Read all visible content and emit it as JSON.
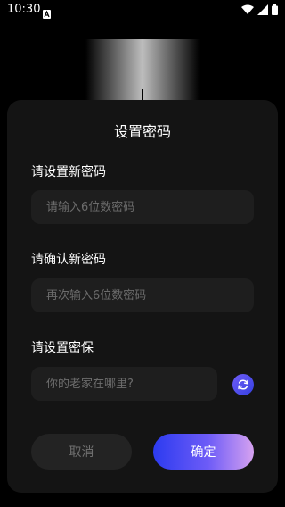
{
  "status": {
    "time": "10:30"
  },
  "dialog": {
    "title": "设置密码",
    "new_password_label": "请设置新密码",
    "new_password_placeholder": "请输入6位数密码",
    "confirm_password_label": "请确认新密码",
    "confirm_password_placeholder": "再次输入6位数密码",
    "security_label": "请设置密保",
    "security_placeholder": "你的老家在哪里?",
    "cancel": "取消",
    "confirm": "确定"
  },
  "colors": {
    "accent_start": "#2c3bf0",
    "accent_end": "#d6a2f0",
    "sheet_bg": "#141414"
  }
}
